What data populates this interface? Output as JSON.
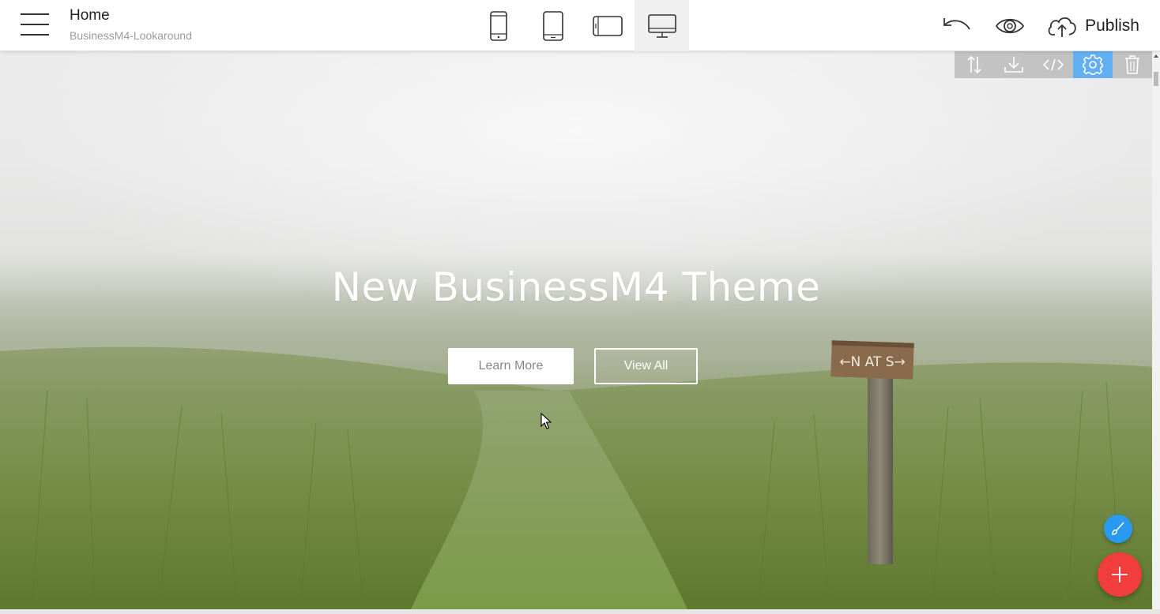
{
  "header": {
    "page_title": "Home",
    "project_name": "BusinessM4-Lookaround",
    "publish_label": "Publish",
    "devices": [
      {
        "name": "mobile",
        "icon": "phone-icon",
        "active": false
      },
      {
        "name": "tablet",
        "icon": "tablet-icon",
        "active": false
      },
      {
        "name": "tablet-landscape",
        "icon": "tablet-landscape-icon",
        "active": false
      },
      {
        "name": "desktop",
        "icon": "desktop-icon",
        "active": true
      }
    ],
    "actions": [
      "undo-icon",
      "preview-eye-icon",
      "cloud-upload-icon"
    ]
  },
  "block_toolbar": {
    "buttons": [
      "reorder-icon",
      "download-icon",
      "code-icon",
      "settings-gear-icon",
      "trash-icon"
    ],
    "active": "settings-gear-icon",
    "active_color": "#62b0f2"
  },
  "hero": {
    "title": "New BusinessM4 Theme",
    "primary_button": "Learn More",
    "secondary_button": "View All",
    "sign_text": "←N AT S→"
  },
  "fabs": {
    "edit_color": "#2a9af0",
    "add_color": "#f23d3d",
    "edit_icon": "brush-icon",
    "add_icon": "plus-icon"
  }
}
